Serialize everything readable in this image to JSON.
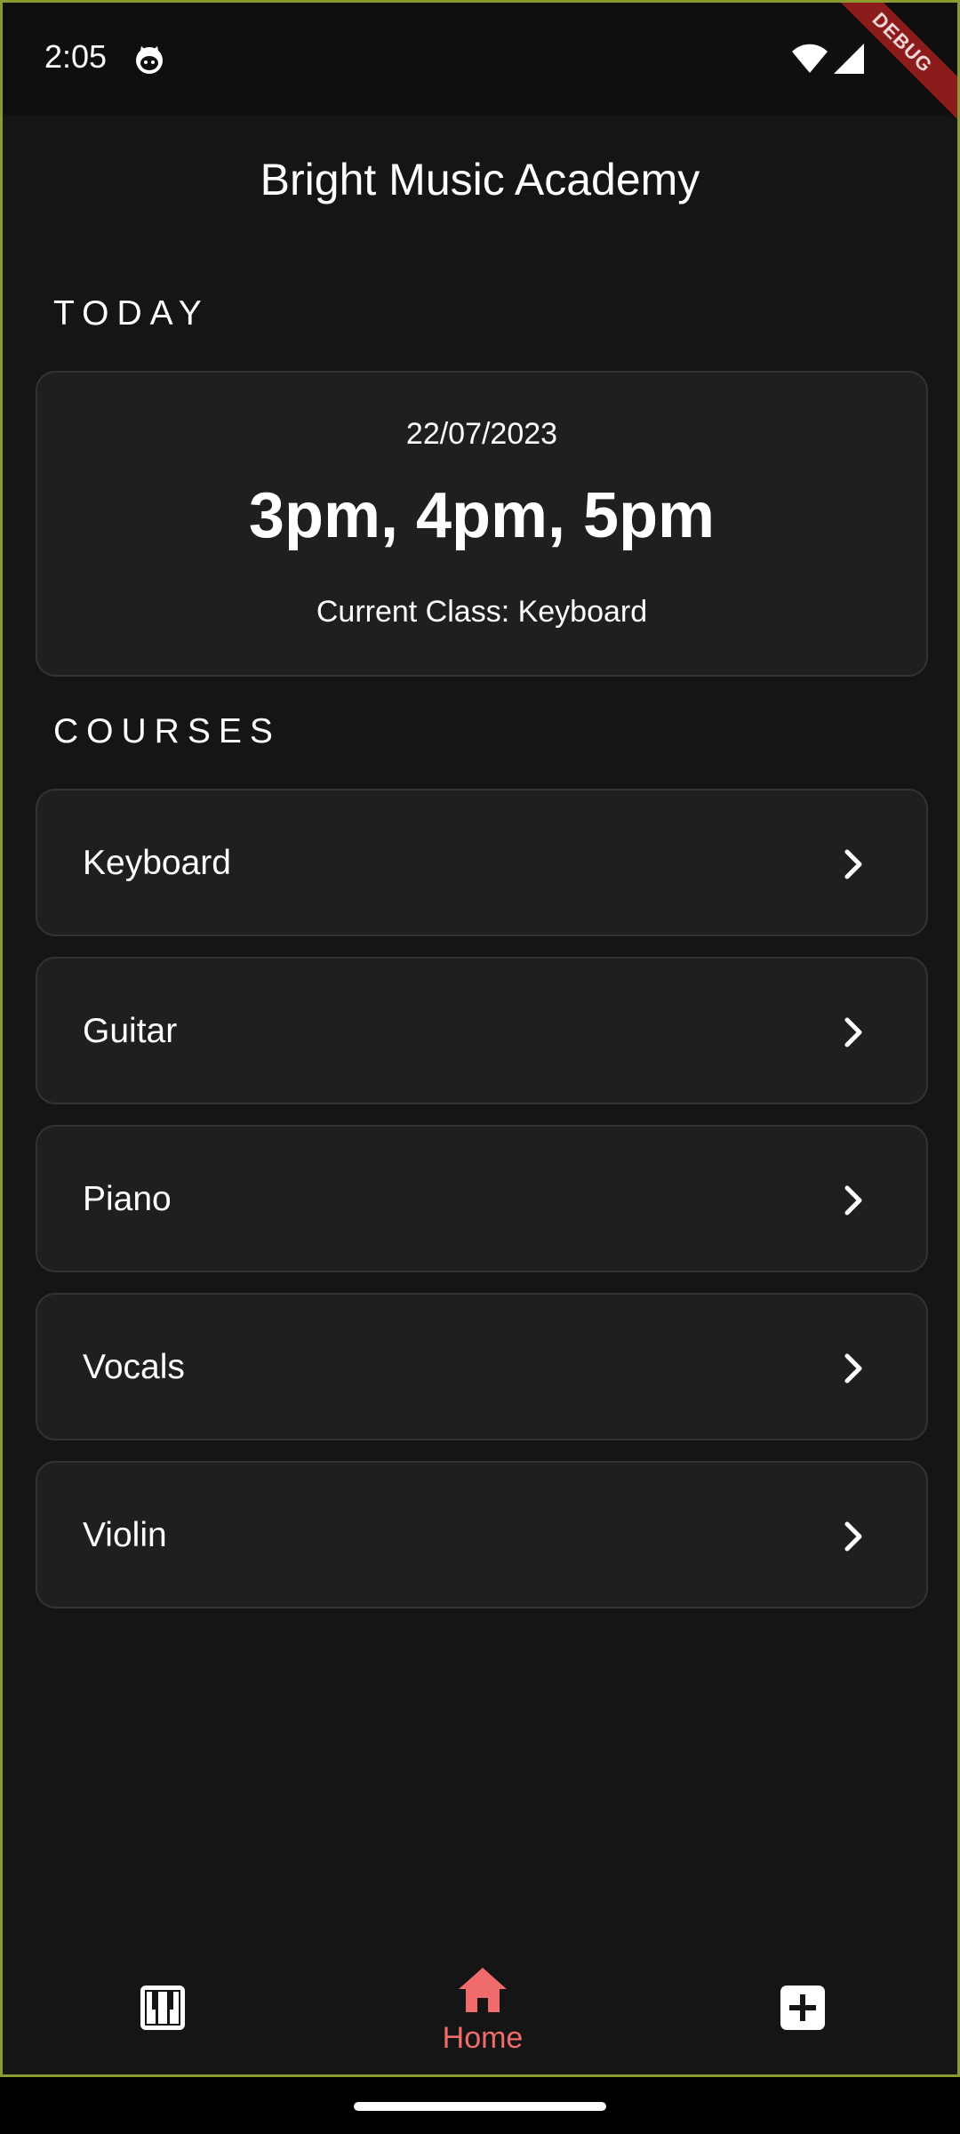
{
  "status_bar": {
    "time": "2:05",
    "debug_banner": "DEBUG"
  },
  "header": {
    "title": "Bright Music Academy"
  },
  "today": {
    "section_label": "TODAY",
    "date": "22/07/2023",
    "times": "3pm, 4pm, 5pm",
    "current_class": "Current Class: Keyboard"
  },
  "courses": {
    "section_label": "COURSES",
    "items": [
      {
        "label": "Keyboard"
      },
      {
        "label": "Guitar"
      },
      {
        "label": "Piano"
      },
      {
        "label": "Vocals"
      },
      {
        "label": "Violin"
      }
    ]
  },
  "bottom_nav": {
    "items": [
      {
        "icon": "piano-icon",
        "label": ""
      },
      {
        "icon": "home-icon",
        "label": "Home",
        "active": true
      },
      {
        "icon": "add-box-icon",
        "label": ""
      }
    ]
  },
  "colors": {
    "background": "#151515",
    "card": "#1f1f1f",
    "card_border": "#333333",
    "accent": "#f06b6b",
    "debug_banner": "#8c1c1c"
  }
}
